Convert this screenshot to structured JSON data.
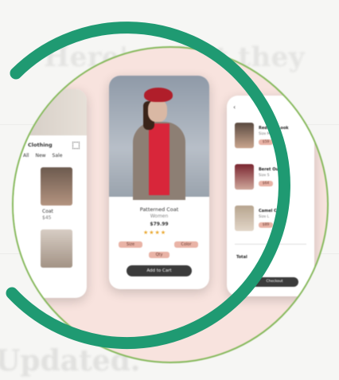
{
  "background": {
    "heading": "Here's what they",
    "footer": "Updated."
  },
  "colors": {
    "ring": "#1f9a72",
    "disc_border": "#86b95c",
    "disc_fill": "#f8e3de",
    "accent_pill": "#e9b3a6",
    "button_dark": "#3b3b3b"
  },
  "screens": {
    "left": {
      "section_title": "Clothing",
      "tabs": [
        "All",
        "New",
        "Sale"
      ],
      "product_name": "Coat",
      "price": "$45"
    },
    "center": {
      "product_title": "Patterned Coat",
      "product_subtitle": "Women",
      "price": "$79.99",
      "rating_stars": "★★★★",
      "size_label": "Size",
      "color_label": "Color",
      "qty_label": "Qty",
      "cart_button": "Add to Cart"
    },
    "right": {
      "items": [
        {
          "name": "Red Hat Look",
          "sub": "Size M",
          "price": "$59"
        },
        {
          "name": "Beret Outfit",
          "sub": "Size S",
          "price": "$64"
        },
        {
          "name": "Camel Coat",
          "sub": "Size L",
          "price": "$89"
        }
      ],
      "total_label": "Total",
      "checkout": "Checkout"
    }
  }
}
